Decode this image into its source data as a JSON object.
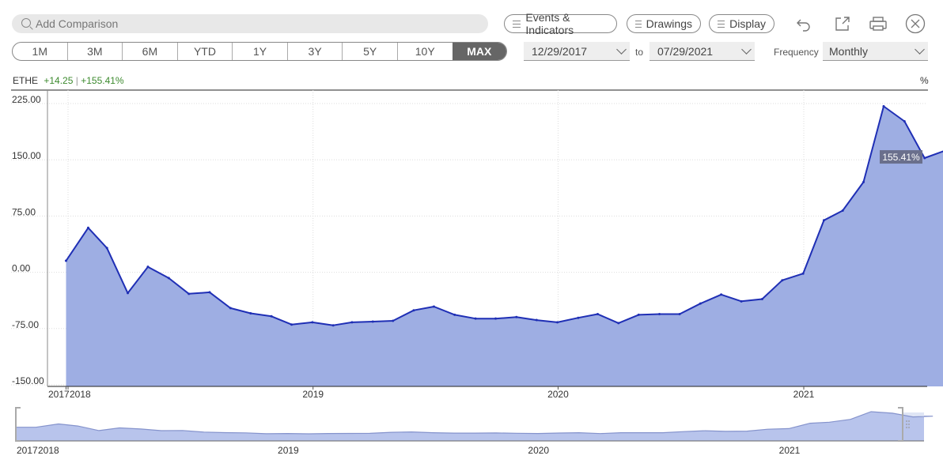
{
  "toolbar": {
    "search_placeholder": "Add Comparison",
    "events_label": "Events & Indicators",
    "drawings_label": "Drawings",
    "display_label": "Display"
  },
  "ranges": [
    "1M",
    "3M",
    "6M",
    "YTD",
    "1Y",
    "3Y",
    "5Y",
    "10Y",
    "MAX"
  ],
  "active_range": "MAX",
  "dates": {
    "from": "12/29/2017",
    "to_label": "to",
    "to": "07/29/2021"
  },
  "frequency": {
    "label": "Frequency",
    "value": "Monthly"
  },
  "legend": {
    "symbol": "ETHE",
    "change": "+14.25",
    "separator": "|",
    "pct": "+155.41%"
  },
  "unit_label": "%",
  "last_value_label": "155.41%",
  "colors": {
    "line": "#1f2fb5",
    "fill": "#9eaee3",
    "positive": "#3c8a2e",
    "nav_fill": "#b8c4ec"
  },
  "chart_data": {
    "type": "area",
    "series": [
      {
        "name": "ETHE",
        "x": [
          "2017-12-29",
          "2018-01-31",
          "2018-02-28",
          "2018-03-31",
          "2018-04-30",
          "2018-05-31",
          "2018-06-30",
          "2018-07-31",
          "2018-08-31",
          "2018-09-30",
          "2018-10-31",
          "2018-11-30",
          "2018-12-31",
          "2019-01-31",
          "2019-02-28",
          "2019-03-31",
          "2019-04-30",
          "2019-05-31",
          "2019-06-30",
          "2019-07-31",
          "2019-08-31",
          "2019-09-30",
          "2019-10-31",
          "2019-11-30",
          "2019-12-31",
          "2020-01-31",
          "2020-02-29",
          "2020-03-31",
          "2020-04-30",
          "2020-05-31",
          "2020-06-30",
          "2020-07-31",
          "2020-08-31",
          "2020-09-30",
          "2020-10-31",
          "2020-11-30",
          "2020-12-31",
          "2021-01-31",
          "2021-02-28",
          "2021-03-31",
          "2021-04-30",
          "2021-05-31",
          "2021-06-30",
          "2021-07-29"
        ],
        "values": [
          9,
          53,
          26,
          -34,
          1,
          -14,
          -35,
          -33,
          -54,
          -61,
          -65,
          -76,
          -73,
          -77,
          -73,
          -72,
          -71,
          -57,
          -52,
          -63,
          -68,
          -68,
          -66,
          -70,
          -73,
          -67,
          -62,
          -74,
          -63,
          -62,
          -62,
          -48,
          -36,
          -45,
          -42,
          -17,
          -8,
          63,
          76,
          114,
          215,
          195,
          146,
          155.41
        ]
      }
    ],
    "y_ticks": [
      "225.00",
      "150.00",
      "75.00",
      "0.00",
      "-75.00",
      "-150.00"
    ],
    "ylim": [
      -150,
      225
    ],
    "x_tick_labels": [
      "2017",
      "2018",
      "2019",
      "2020",
      "2021"
    ],
    "grid": true
  }
}
